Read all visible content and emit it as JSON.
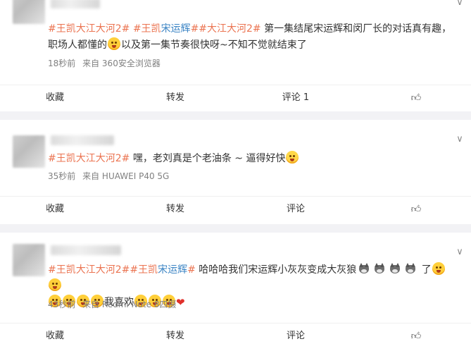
{
  "posts": [
    {
      "parts": [
        {
          "kind": "topic",
          "text": "#王凯大江大河2#"
        },
        {
          "kind": "text",
          "text": " "
        },
        {
          "kind": "topic-mixed",
          "a": "#王凯",
          "b": "宋运辉",
          "c": "##大江大河2#"
        },
        {
          "kind": "text",
          "text": " 第一集结尾宋运辉和闵厂长的对话真有趣，职场人都懂的"
        },
        {
          "kind": "emoji",
          "name": "tongue-face-emoji"
        },
        {
          "kind": "text",
          "text": "以及第一集节奏很快呀~不知不觉就结束了"
        }
      ],
      "time": "18秒前",
      "source": "来自 360安全浏览器",
      "actions": {
        "favorite": "收藏",
        "repost": "转发",
        "comment": "评论 1",
        "like_icon": "thumbs-up-icon"
      }
    },
    {
      "parts": [
        {
          "kind": "topic",
          "text": "#王凯大江大河2#"
        },
        {
          "kind": "text",
          "text": " 嘿，老刘真是个老油条 ~ 逼得好快"
        },
        {
          "kind": "emoji",
          "name": "laughing-emoji"
        }
      ],
      "time": "35秒前",
      "source": "来自 HUAWEI P40 5G",
      "actions": {
        "favorite": "收藏",
        "repost": "转发",
        "comment": "评论",
        "like_icon": "thumbs-up-icon"
      }
    },
    {
      "parts": [
        {
          "kind": "topic",
          "text": "#王凯大江大河2#"
        },
        {
          "kind": "topic-mixed",
          "a": "#王凯",
          "b": "宋运辉",
          "c": "#"
        },
        {
          "kind": "text",
          "text": " 哈哈哈我们宋运辉小灰灰变成大灰狼"
        },
        {
          "kind": "wolves",
          "count": 4
        },
        {
          "kind": "text",
          "text": " 了"
        },
        {
          "kind": "emoji-row",
          "count": 2
        }
      ],
      "line2_emojis_a": 4,
      "line2_text": "我喜欢",
      "line2_emojis_b": 3,
      "time": "43秒前",
      "source": "来自 Redmi Note 8四摄",
      "actions": {
        "favorite": "收藏",
        "repost": "转发",
        "comment": "评论",
        "like_icon": "thumbs-up-icon"
      }
    }
  ],
  "colors": {
    "topic": "#eb7350",
    "topic_highlight": "#3b84c4",
    "meta": "#808080",
    "background": "#f2f2f5"
  }
}
